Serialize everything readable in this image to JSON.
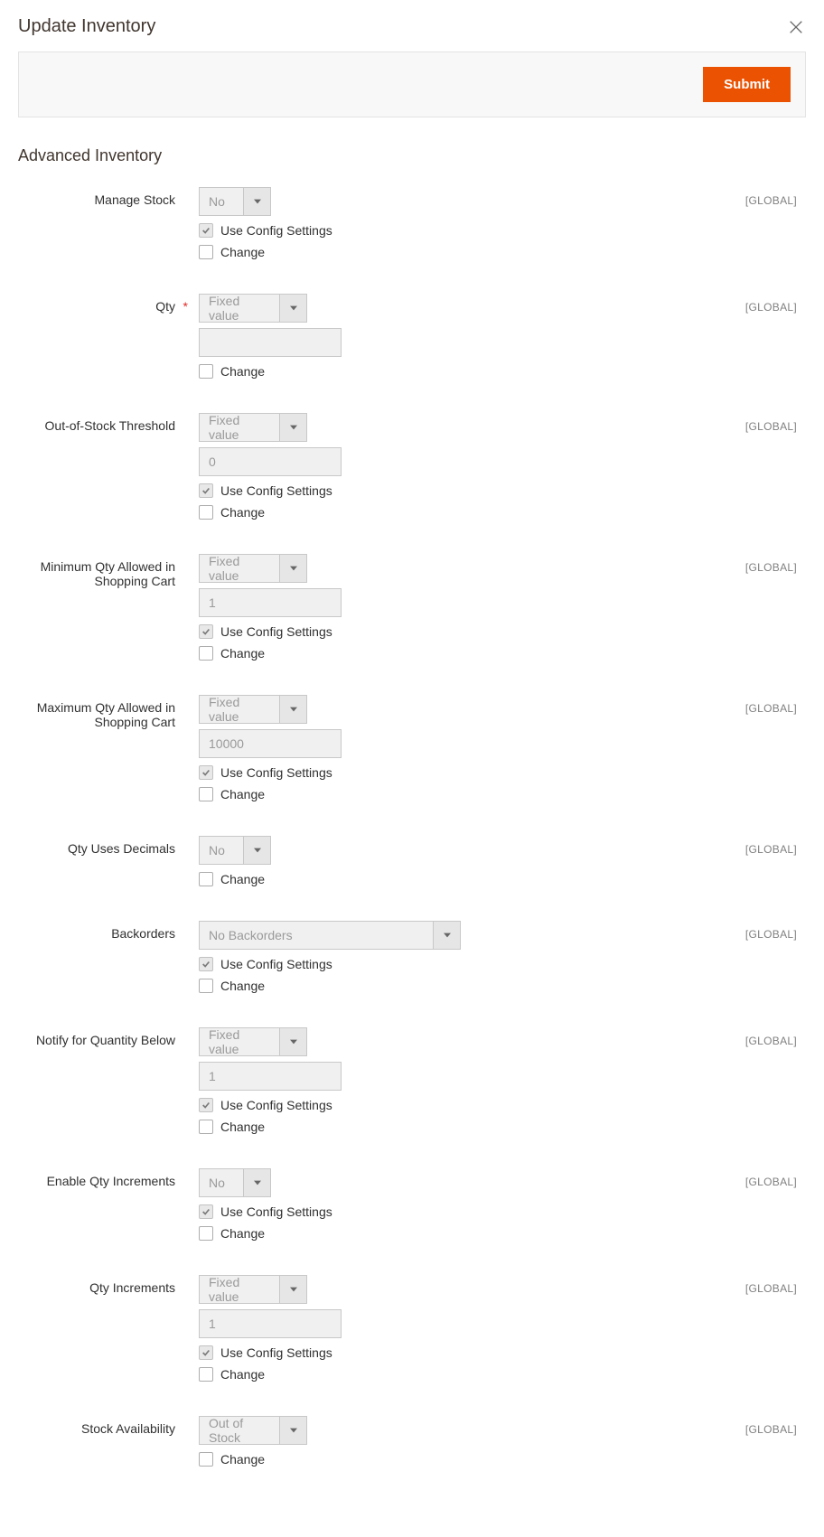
{
  "modal": {
    "title": "Update Inventory",
    "submit_label": "Submit",
    "section_title": "Advanced Inventory",
    "scope_label": "[GLOBAL]",
    "use_config_label": "Use Config Settings",
    "change_label": "Change"
  },
  "fields": {
    "manage_stock": {
      "label": "Manage Stock",
      "value": "No"
    },
    "qty": {
      "label": "Qty",
      "mode": "Fixed value",
      "value": ""
    },
    "out_of_stock_threshold": {
      "label": "Out-of-Stock Threshold",
      "mode": "Fixed value",
      "value": "0"
    },
    "min_qty_cart": {
      "label": "Minimum Qty Allowed in Shopping Cart",
      "mode": "Fixed value",
      "value": "1"
    },
    "max_qty_cart": {
      "label": "Maximum Qty Allowed in Shopping Cart",
      "mode": "Fixed value",
      "value": "10000"
    },
    "qty_decimals": {
      "label": "Qty Uses Decimals",
      "value": "No"
    },
    "backorders": {
      "label": "Backorders",
      "value": "No Backorders"
    },
    "notify_qty_below": {
      "label": "Notify for Quantity Below",
      "mode": "Fixed value",
      "value": "1"
    },
    "enable_qty_increments": {
      "label": "Enable Qty Increments",
      "value": "No"
    },
    "qty_increments": {
      "label": "Qty Increments",
      "mode": "Fixed value",
      "value": "1"
    },
    "stock_availability": {
      "label": "Stock Availability",
      "value": "Out of Stock"
    }
  }
}
